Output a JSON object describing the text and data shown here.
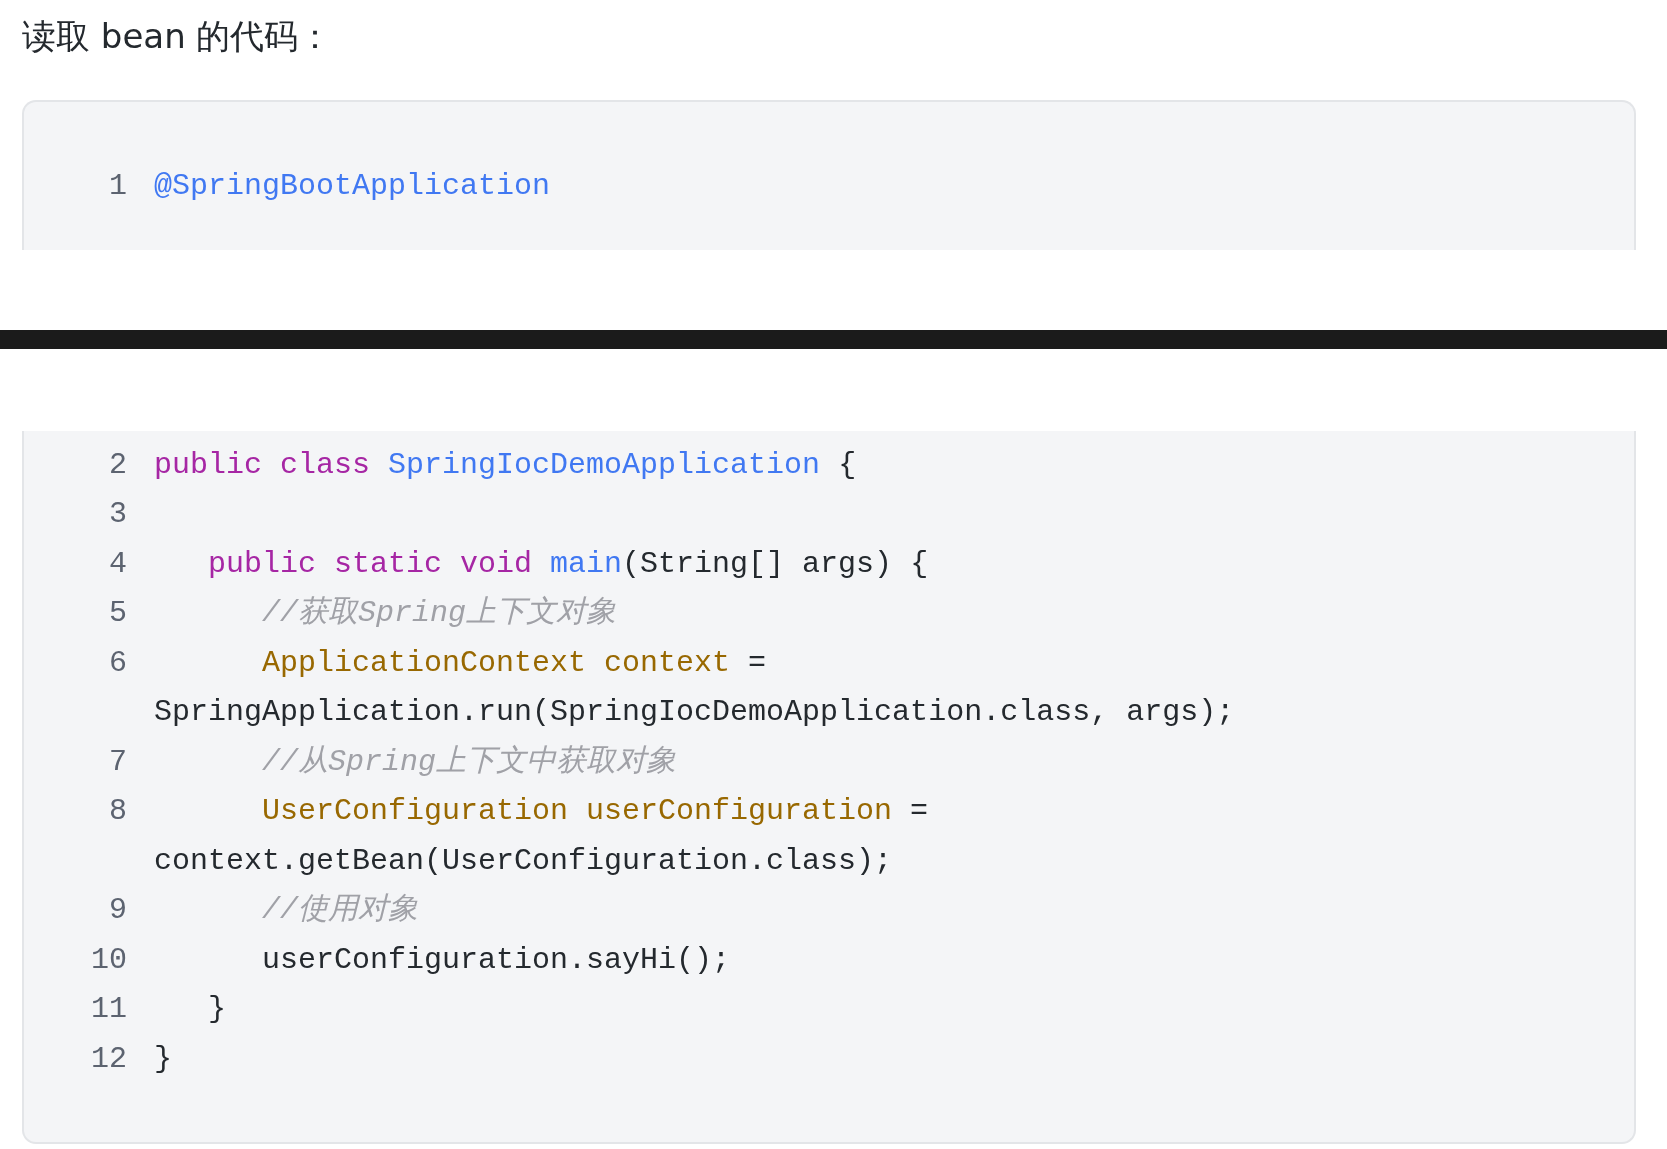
{
  "heading": "读取 bean 的代码：",
  "code_blocks": [
    {
      "rows": [
        {
          "number": "1",
          "tokens": [
            {
              "kind": "meta",
              "text": "@SpringBootApplication"
            }
          ]
        }
      ]
    },
    {
      "rows": [
        {
          "number": "2",
          "tokens": [
            {
              "kind": "keyword",
              "text": "public class "
            },
            {
              "kind": "title",
              "text": "SpringIocDemoApplication"
            },
            {
              "kind": "plain",
              "text": " {"
            }
          ],
          "children": [
            {
              "number": "3"
            },
            {
              "number": "4",
              "tokens": [
                {
                  "kind": "keyword",
                  "text": "public static void "
                },
                {
                  "kind": "title",
                  "text": "main"
                },
                {
                  "kind": "plain",
                  "text": "(String[] args) {"
                }
              ],
              "children": [
                {
                  "number": "5",
                  "tokens": [
                    {
                      "kind": "comment",
                      "text": "//获取Spring上下文对象"
                    }
                  ]
                },
                {
                  "number": "6",
                  "tokens": [
                    {
                      "kind": "type",
                      "text": "ApplicationContext context"
                    },
                    {
                      "kind": "plain",
                      "text": " ="
                    }
                  ]
                },
                {
                  "kind": "continuation",
                  "tokens": [
                    {
                      "kind": "plain",
                      "text": "SpringApplication.run(SpringIocDemoApplication.class, args);"
                    }
                  ]
                },
                {
                  "number": "7",
                  "tokens": [
                    {
                      "kind": "comment",
                      "text": "//从Spring上下文中获取对象"
                    }
                  ]
                },
                {
                  "number": "8",
                  "tokens": [
                    {
                      "kind": "type",
                      "text": "UserConfiguration userConfiguration"
                    },
                    {
                      "kind": "plain",
                      "text": " ="
                    }
                  ]
                },
                {
                  "kind": "continuation",
                  "tokens": [
                    {
                      "kind": "plain",
                      "text": "context.getBean(UserConfiguration.class);"
                    }
                  ]
                },
                {
                  "number": "9",
                  "tokens": [
                    {
                      "kind": "comment",
                      "text": "//使用对象"
                    }
                  ]
                },
                {
                  "number": "10",
                  "tokens": [
                    {
                      "kind": "plain",
                      "text": "userConfiguration.sayHi();"
                    }
                  ]
                }
              ]
            },
            {
              "number": "11",
              "tokens": [
                {
                  "kind": "plain",
                  "text": "}"
                }
              ]
            }
          ]
        },
        {
          "number": "12",
          "tokens": [
            {
              "kind": "plain",
              "text": "}"
            }
          ]
        }
      ]
    }
  ]
}
